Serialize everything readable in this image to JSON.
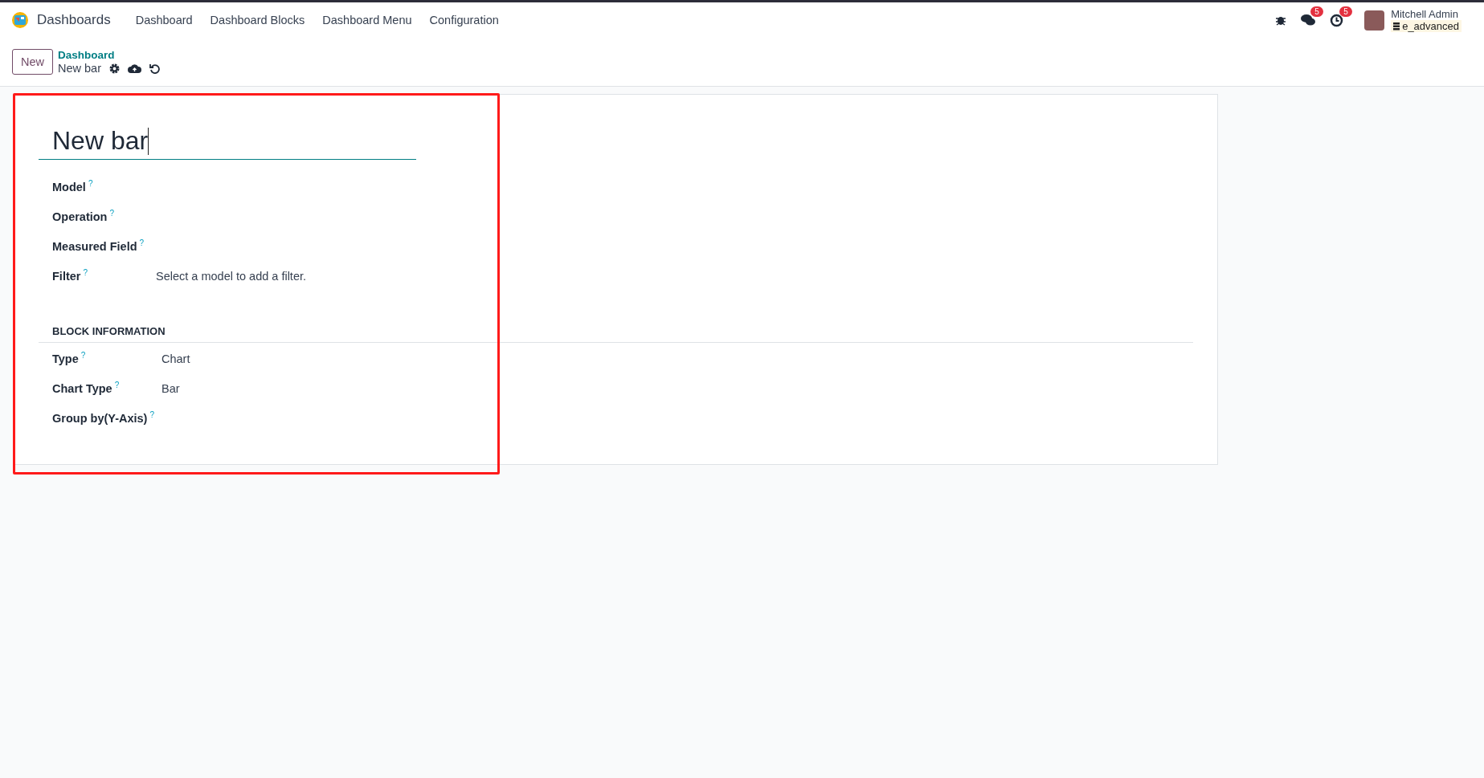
{
  "navbar": {
    "app_name": "Dashboards",
    "menu": [
      "Dashboard",
      "Dashboard Blocks",
      "Dashboard Menu",
      "Configuration"
    ],
    "notifications": [
      {
        "kind": "messages",
        "count": "5"
      },
      {
        "kind": "activities",
        "count": "5"
      }
    ],
    "user": {
      "name": "Mitchell Admin",
      "database": "e_advanced"
    }
  },
  "control_panel": {
    "new_button": "New",
    "breadcrumb": "Dashboard",
    "record_name": "New bar"
  },
  "form": {
    "title": "New bar",
    "fields": [
      {
        "label": "Model",
        "help": "?"
      },
      {
        "label": "Operation",
        "help": "?"
      },
      {
        "label": "Measured Field",
        "help": "?"
      },
      {
        "label": "Filter",
        "help": "?",
        "value": "Select a model to add a filter."
      }
    ],
    "section": {
      "title": "BLOCK INFORMATION",
      "fields": [
        {
          "label": "Type",
          "help": "?",
          "value": "Chart"
        },
        {
          "label": "Chart Type",
          "help": "?",
          "value": "Bar"
        },
        {
          "label": "Group by(Y-Axis)",
          "help": "?"
        }
      ]
    }
  }
}
